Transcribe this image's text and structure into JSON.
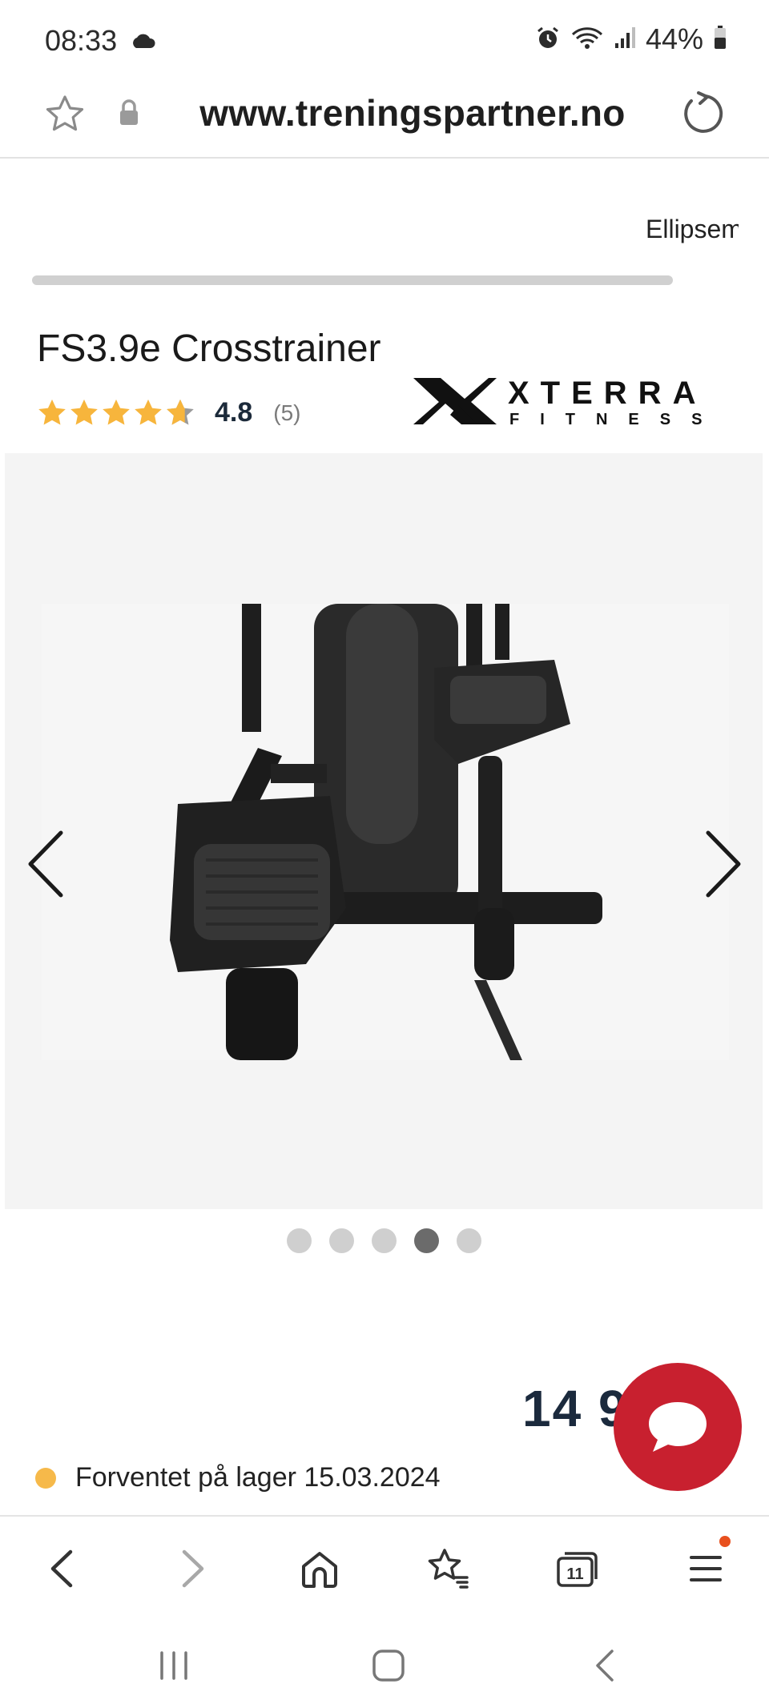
{
  "status_bar": {
    "time": "08:33",
    "battery": "44%",
    "icons": [
      "cloud-icon",
      "alarm-icon",
      "wifi-icon",
      "signal-icon",
      "battery-icon"
    ]
  },
  "browser": {
    "url": "www.treningspartner.no",
    "icons": [
      "star-icon",
      "lock-icon",
      "reload-icon"
    ]
  },
  "page": {
    "breadcrumb": "Ellipsemaskiner",
    "product_title": "FS3.9e Crosstrainer",
    "rating": {
      "value": "4.8",
      "count": "(5)",
      "stars": 4.8,
      "star_color": "#f7b53c"
    },
    "brand_logo": {
      "line1": "XTERRA",
      "line2": "FITNESS"
    },
    "gallery": {
      "total_images": 5,
      "active_index": 3,
      "image_alt": "Close-up of crosstrainer pedals"
    },
    "price": "14 9",
    "stock_status": "Forventet på lager 15.03.2024",
    "stock_color": "#f6b94a",
    "chat_color": "#c8202f"
  },
  "toolbar": {
    "tabs_count": "11",
    "items": [
      "back-icon",
      "forward-icon",
      "home-icon",
      "bookmarks-icon",
      "tabs-icon",
      "menu-icon"
    ]
  },
  "system_nav": {
    "items": [
      "recents-icon",
      "home-icon",
      "back-icon"
    ]
  }
}
